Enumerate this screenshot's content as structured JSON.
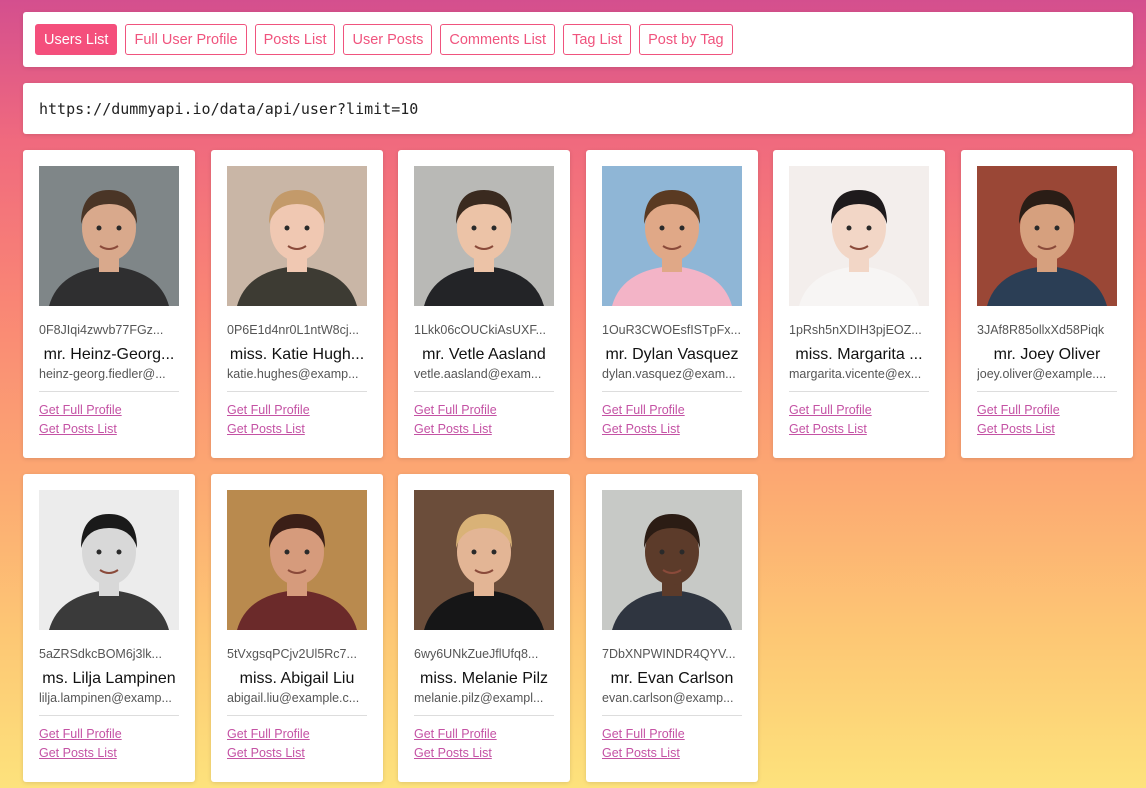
{
  "tabs": [
    {
      "label": "Users List",
      "active": true
    },
    {
      "label": "Full User Profile",
      "active": false
    },
    {
      "label": "Posts List",
      "active": false
    },
    {
      "label": "User Posts",
      "active": false
    },
    {
      "label": "Comments List",
      "active": false
    },
    {
      "label": "Tag List",
      "active": false
    },
    {
      "label": "Post by Tag",
      "active": false
    }
  ],
  "url": "https://dummyapi.io/data/api/user?limit=10",
  "link_labels": {
    "profile": "Get Full Profile",
    "posts": "Get Posts List"
  },
  "users": [
    {
      "id": "0F8JIqi4zwvb77FGz...",
      "name": "mr. Heinz-Georg...",
      "email": "heinz-georg.fiedler@...",
      "photo": {
        "bg": "#7f8688",
        "skin": "#d9a98c",
        "hair": "#4a3526",
        "shirt": "#2f2f30"
      }
    },
    {
      "id": "0P6E1d4nr0L1ntW8cj...",
      "name": "miss. Katie Hugh...",
      "email": "katie.hughes@examp...",
      "photo": {
        "bg": "#c9b6a6",
        "skin": "#f0c8b2",
        "hair": "#c39a6a",
        "shirt": "#3d3b33"
      }
    },
    {
      "id": "1Lkk06cOUCkiAsUXF...",
      "name": "mr. Vetle Aasland",
      "email": "vetle.aasland@exam...",
      "photo": {
        "bg": "#b9b9b6",
        "skin": "#ecc3a7",
        "hair": "#3a2a1f",
        "shirt": "#232427"
      }
    },
    {
      "id": "1OuR3CWOEsfISTpFx...",
      "name": "mr. Dylan Vasquez",
      "email": "dylan.vasquez@exam...",
      "photo": {
        "bg": "#8fb6d6",
        "skin": "#e0a887",
        "hair": "#5a3a22",
        "shirt": "#f3b4c7"
      }
    },
    {
      "id": "1pRsh5nXDIH3pjEOZ...",
      "name": "miss. Margarita ...",
      "email": "margarita.vicente@ex...",
      "photo": {
        "bg": "#f3eeec",
        "skin": "#f2d6c6",
        "hair": "#1e1a1c",
        "shirt": "#f7f5f4"
      }
    },
    {
      "id": "3JAf8R85ollxXd58Piqk",
      "name": "mr. Joey Oliver",
      "email": "joey.oliver@example....",
      "photo": {
        "bg": "#9a4736",
        "skin": "#d6a07e",
        "hair": "#2a1d16",
        "shirt": "#2b3e55"
      }
    },
    {
      "id": "5aZRSdkcBOM6j3lk...",
      "name": "ms. Lilja Lampinen",
      "email": "lilja.lampinen@examp...",
      "photo": {
        "bg": "#ececec",
        "skin": "#d8d8d8",
        "hair": "#1a1a1a",
        "shirt": "#3a3a3a"
      }
    },
    {
      "id": "5tVxgsqPCjv2Ul5Rc7...",
      "name": "miss. Abigail Liu",
      "email": "abigail.liu@example.c...",
      "photo": {
        "bg": "#b98a4e",
        "skin": "#d69b7c",
        "hair": "#3b1f17",
        "shirt": "#6b2a2a"
      }
    },
    {
      "id": "6wy6UNkZueJflUfq8...",
      "name": "miss. Melanie Pilz",
      "email": "melanie.pilz@exampl...",
      "photo": {
        "bg": "#6b4d3a",
        "skin": "#e3b595",
        "hair": "#d9b277",
        "shirt": "#161617"
      }
    },
    {
      "id": "7DbXNPWINDR4QYV...",
      "name": "mr. Evan Carlson",
      "email": "evan.carlson@examp...",
      "photo": {
        "bg": "#c7c9c6",
        "skin": "#5c3b2a",
        "hair": "#2b1c14",
        "shirt": "#2f3540"
      }
    }
  ]
}
